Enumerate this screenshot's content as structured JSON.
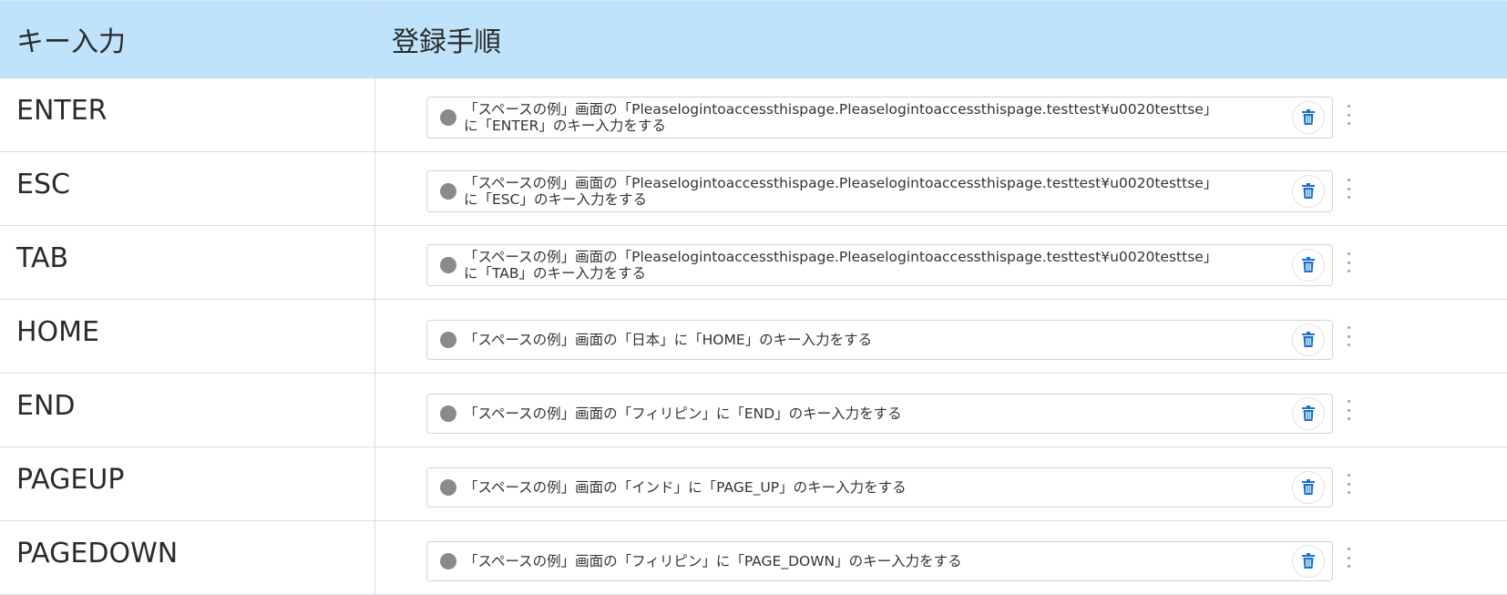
{
  "header": {
    "col1": "キー入力",
    "col2": "登録手順"
  },
  "rows": [
    {
      "key": "ENTER",
      "step_line1": "「スペースの例」画面の「Pleaselogintoaccessthispage.Pleaselogintoaccessthispage.testtest¥u0020testtse」",
      "step_line2": "に「ENTER」のキー入力をする"
    },
    {
      "key": "ESC",
      "step_line1": "「スペースの例」画面の「Pleaselogintoaccessthispage.Pleaselogintoaccessthispage.testtest¥u0020testtse」",
      "step_line2": "に「ESC」のキー入力をする"
    },
    {
      "key": "TAB",
      "step_line1": "「スペースの例」画面の「Pleaselogintoaccessthispage.Pleaselogintoaccessthispage.testtest¥u0020testtse」",
      "step_line2": "に「TAB」のキー入力をする"
    },
    {
      "key": "HOME",
      "step_line1": "「スペースの例」画面の「日本」に「HOME」のキー入力をする"
    },
    {
      "key": "END",
      "step_line1": "「スペースの例」画面の「フィリピン」に「END」のキー入力をする"
    },
    {
      "key": "PAGEUP",
      "step_line1": "「スペースの例」画面の「インド」に「PAGE_UP」のキー入力をする"
    },
    {
      "key": "PAGEDOWN",
      "step_line1": "「スペースの例」画面の「フィリピン」に「PAGE_DOWN」のキー入力をする"
    }
  ],
  "icons": {
    "status": "status-dot-icon",
    "delete": "trash-icon",
    "more": "kebab-menu-icon"
  },
  "colors": {
    "header_bg": "#bfe3fb",
    "dot": "#8a8a8a",
    "trash_blue": "#1a73c8"
  }
}
